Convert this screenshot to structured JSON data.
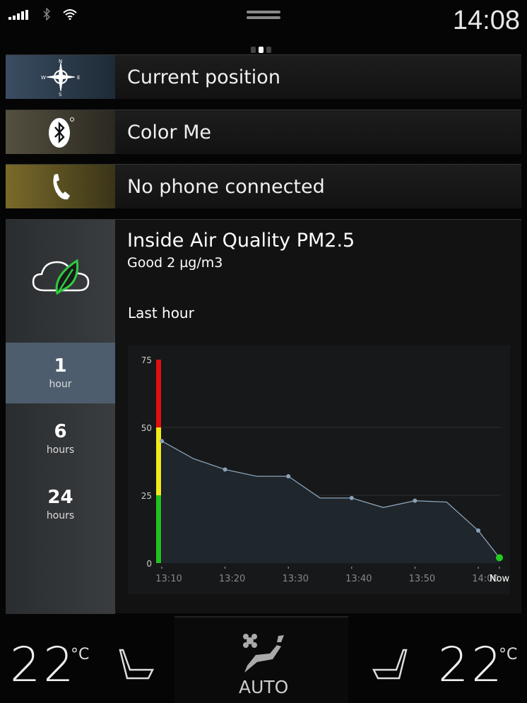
{
  "status": {
    "signal_icon": "signal-bars-icon",
    "bluetooth_icon": "bluetooth-icon",
    "wifi_icon": "wifi-icon",
    "time": "14:08",
    "page_index": 2,
    "page_count": 3
  },
  "tiles": [
    {
      "label": "Current position",
      "icon": "compass-icon",
      "color": "#2e3f52"
    },
    {
      "label": "Color Me",
      "icon": "bluetooth-icon",
      "color": "#4a4535"
    },
    {
      "label": "No phone connected",
      "icon": "phone-icon",
      "color": "#7a6a2a"
    }
  ],
  "air": {
    "title": "Inside Air Quality PM2.5",
    "status": "Good  2 µg/m3",
    "period_label": "Last hour",
    "icon": "cloud-leaf-icon",
    "ranges": [
      {
        "value": "1",
        "unit": "hour",
        "selected": true
      },
      {
        "value": "6",
        "unit": "hours",
        "selected": false
      },
      {
        "value": "24",
        "unit": "hours",
        "selected": false
      }
    ]
  },
  "chart_data": {
    "type": "area",
    "ylim": [
      0,
      75
    ],
    "yticks": [
      0,
      25,
      50,
      75
    ],
    "xticks": [
      "13:10",
      "13:20",
      "13:30",
      "13:40",
      "13:50",
      "14:00",
      "Now"
    ],
    "x": [
      "13:10",
      "13:15",
      "13:20",
      "13:25",
      "13:30",
      "13:35",
      "13:40",
      "13:45",
      "13:50",
      "13:55",
      "14:00",
      "Now"
    ],
    "values": [
      45,
      38.5,
      34.5,
      32,
      32,
      24,
      24,
      20.5,
      23,
      22.5,
      12,
      2
    ],
    "bands": [
      {
        "from": 0,
        "to": 25,
        "color": "#22c022"
      },
      {
        "from": 25,
        "to": 50,
        "color": "#f2ea1a"
      },
      {
        "from": 50,
        "to": 75,
        "color": "#e01010"
      }
    ],
    "line_color": "#8aa2b8",
    "current_color": "#22cc22",
    "grid": true
  },
  "climate": {
    "left_temp": "22",
    "right_temp": "22",
    "unit": "°C",
    "mode": "AUTO"
  }
}
